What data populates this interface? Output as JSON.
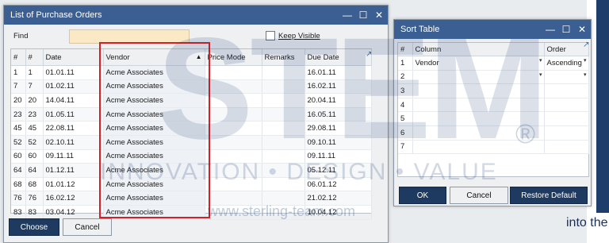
{
  "background": {
    "text": "into the"
  },
  "po_window": {
    "title": "List of Purchase Orders",
    "find_label": "Find",
    "find_value": "",
    "keep_visible_label": "Keep Visible",
    "keep_visible_checked": false,
    "columns": [
      "#",
      "#",
      "Date",
      "Vendor",
      "Price Mode",
      "Remarks",
      "Due Date"
    ],
    "rows": [
      [
        "1",
        "1",
        "01.01.11",
        "Acme Associates",
        "",
        "",
        "16.01.11"
      ],
      [
        "7",
        "7",
        "01.02.11",
        "Acme Associates",
        "",
        "",
        "16.02.11"
      ],
      [
        "20",
        "20",
        "14.04.11",
        "Acme Associates",
        "",
        "",
        "20.04.11"
      ],
      [
        "23",
        "23",
        "01.05.11",
        "Acme Associates",
        "",
        "",
        "16.05.11"
      ],
      [
        "45",
        "45",
        "22.08.11",
        "Acme Associates",
        "",
        "",
        "29.08.11"
      ],
      [
        "52",
        "52",
        "02.10.11",
        "Acme Associates",
        "",
        "",
        "09.10.11"
      ],
      [
        "60",
        "60",
        "09.11.11",
        "Acme Associates",
        "",
        "",
        "09.11.11"
      ],
      [
        "64",
        "64",
        "01.12.11",
        "Acme Associates",
        "",
        "",
        "05.12.11"
      ],
      [
        "68",
        "68",
        "01.01.12",
        "Acme Associates",
        "",
        "",
        "06.01.12"
      ],
      [
        "76",
        "76",
        "16.02.12",
        "Acme Associates",
        "",
        "",
        "21.02.12"
      ],
      [
        "83",
        "83",
        "03.04.12",
        "Acme Associates",
        "",
        "",
        "10.04.12"
      ]
    ],
    "choose_label": "Choose",
    "cancel_label": "Cancel",
    "sort_indicator": "▲"
  },
  "sort_window": {
    "title": "Sort Table",
    "columns": [
      "#",
      "Column",
      "Order"
    ],
    "rows": [
      [
        "1",
        "Vendor",
        "Ascending"
      ],
      [
        "2",
        "",
        ""
      ],
      [
        "3",
        "",
        ""
      ],
      [
        "4",
        "",
        ""
      ],
      [
        "5",
        "",
        ""
      ],
      [
        "6",
        "",
        ""
      ],
      [
        "7",
        "",
        ""
      ]
    ],
    "ok_label": "OK",
    "cancel_label": "Cancel",
    "restore_label": "Restore Default"
  },
  "watermark": {
    "brand": "STEM",
    "registered": "®",
    "tagline": "INNOVATION • DESIGN • VALUE",
    "url": "www.sterling-team.com"
  },
  "colors": {
    "titlebar": "#3b5f93",
    "primary_button": "#1f3a60",
    "highlight_box": "#d61f26",
    "find_field": "#fbe9c6"
  }
}
